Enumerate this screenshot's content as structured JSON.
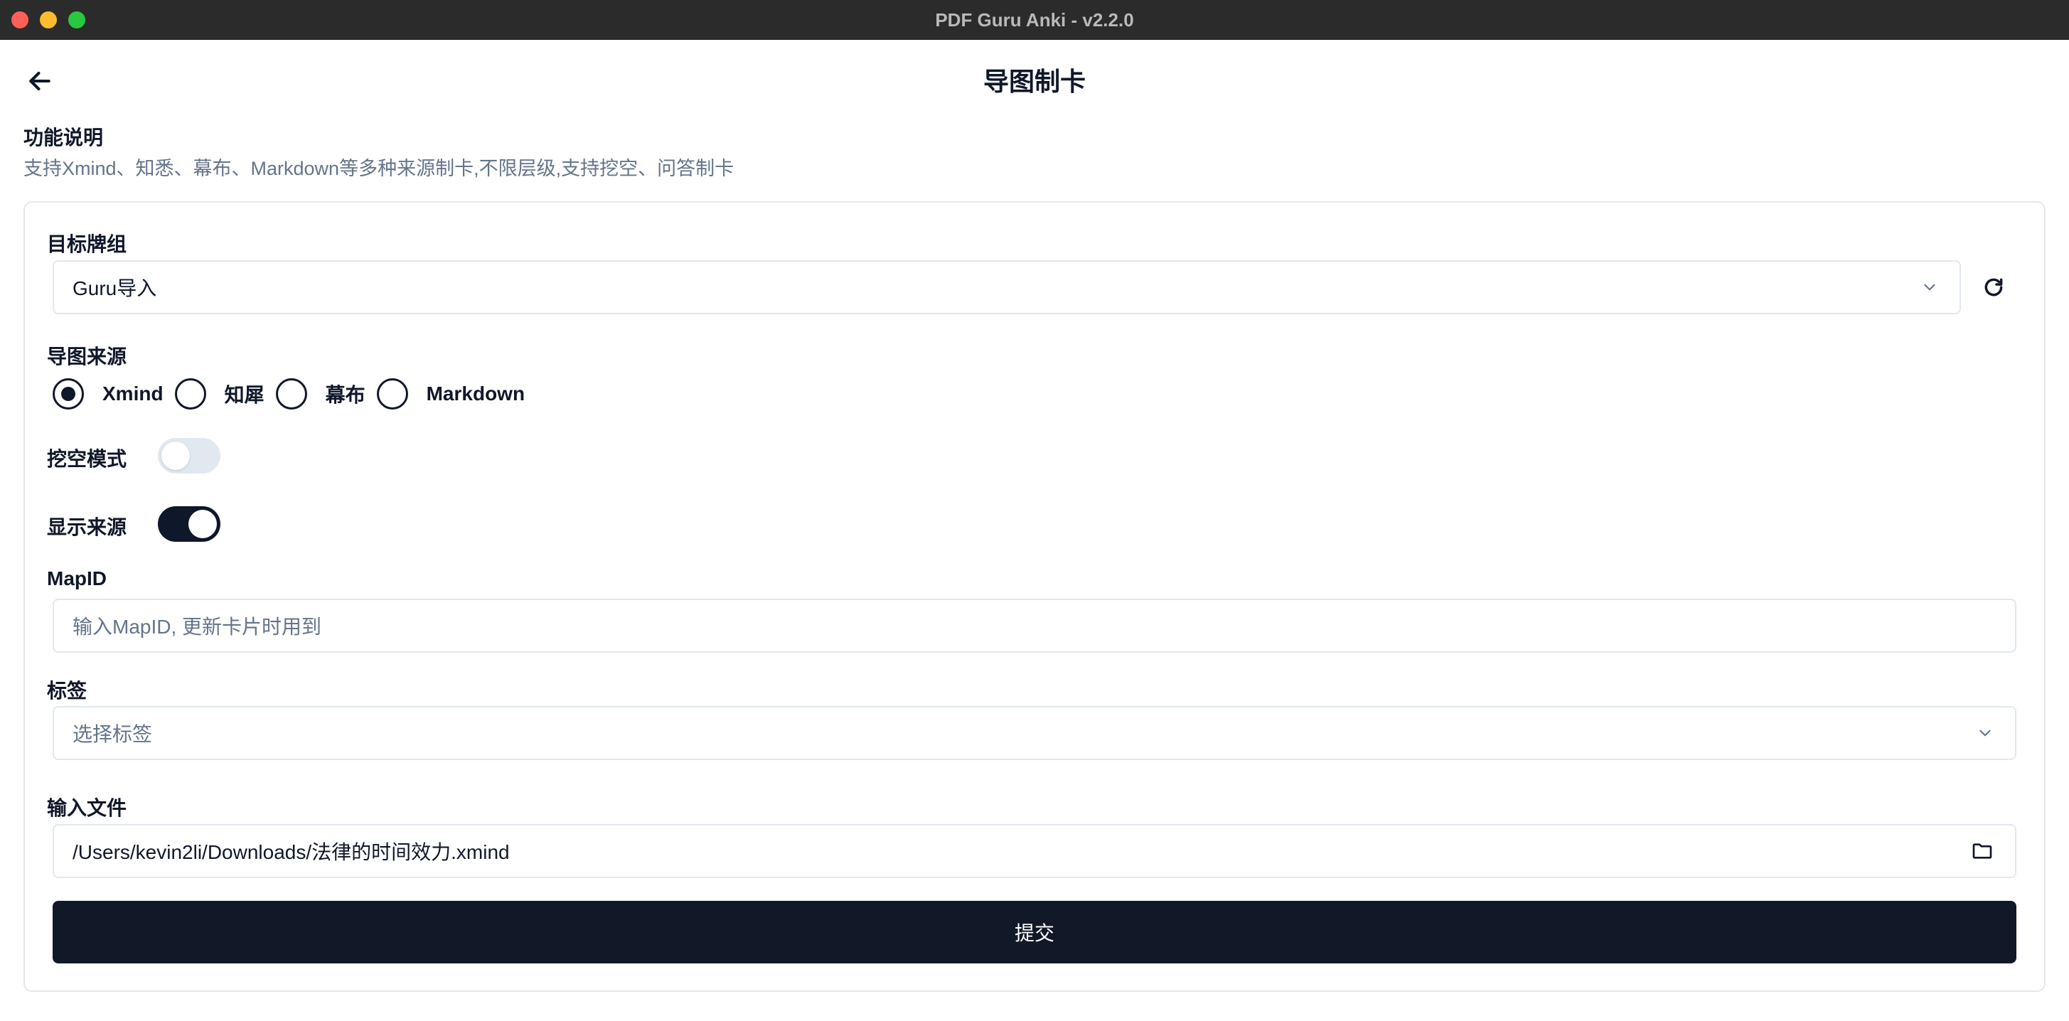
{
  "window": {
    "title": "PDF Guru Anki - v2.2.0"
  },
  "header": {
    "title": "导图制卡",
    "back_icon": "arrow-left-icon"
  },
  "description": {
    "title": "功能说明",
    "text": "支持Xmind、知悉、幕布、Markdown等多种来源制卡,不限层级,支持挖空、问答制卡"
  },
  "form": {
    "deck": {
      "label": "目标牌组",
      "value": "Guru导入"
    },
    "source": {
      "label": "导图来源",
      "options": [
        "Xmind",
        "知犀",
        "幕布",
        "Markdown"
      ],
      "selected": "Xmind"
    },
    "cloze_mode": {
      "label": "挖空模式",
      "enabled": false
    },
    "show_source": {
      "label": "显示来源",
      "enabled": true
    },
    "map_id": {
      "label": "MapID",
      "placeholder": "输入MapID, 更新卡片时用到",
      "value": ""
    },
    "tags": {
      "label": "标签",
      "placeholder": "选择标签"
    },
    "input_file": {
      "label": "输入文件",
      "value": "/Users/kevin2li/Downloads/法律的时间效力.xmind"
    },
    "submit_label": "提交"
  },
  "colors": {
    "primary": "#0f172a",
    "muted_text": "#64748b",
    "border": "#e2e8f0",
    "titlebar": "#2b2b2b"
  }
}
